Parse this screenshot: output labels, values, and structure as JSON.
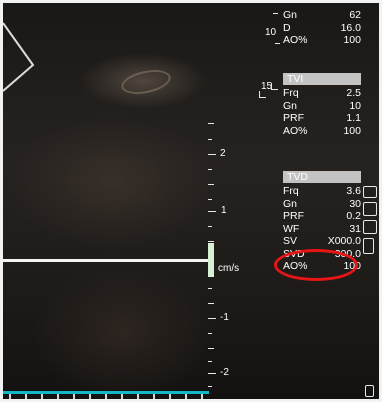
{
  "top_panel": {
    "rows": [
      {
        "label": "Gn",
        "value": "62"
      },
      {
        "label": "D",
        "value": "16.0"
      },
      {
        "label": "AO%",
        "value": "100"
      }
    ]
  },
  "tvi_panel": {
    "title": "TVI",
    "rows": [
      {
        "label": "Frq",
        "value": "2.5"
      },
      {
        "label": "Gn",
        "value": "10"
      },
      {
        "label": "PRF",
        "value": "1.1"
      },
      {
        "label": "AO%",
        "value": "100"
      }
    ]
  },
  "tvd_panel": {
    "title": "TVD",
    "rows": [
      {
        "label": "Frq",
        "value": "3.6"
      },
      {
        "label": "Gn",
        "value": "30"
      },
      {
        "label": "PRF",
        "value": "0.2"
      },
      {
        "label": "WF",
        "value": "31"
      },
      {
        "label": "SV",
        "value": "X000.0"
      },
      {
        "label": "SVD",
        "value": "300.0"
      },
      {
        "label": "AO%",
        "value": "100"
      }
    ]
  },
  "depth_marks": [
    "10",
    "15"
  ],
  "velocity_scale": {
    "unit": "cm/s",
    "labels": [
      "2",
      "1",
      "-1",
      "-2"
    ]
  },
  "colors": {
    "highlight_oval": "#e81515",
    "header_bg": "#c3c3c3",
    "bottom_bar": "#12b7c8"
  }
}
